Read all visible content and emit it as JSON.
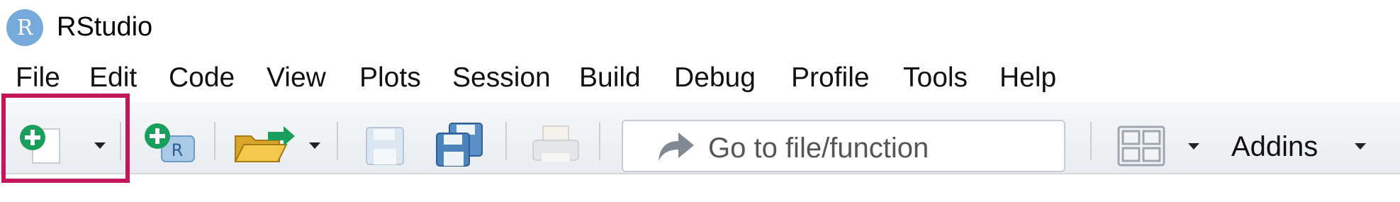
{
  "app": {
    "title": "RStudio",
    "logo_letter": "R"
  },
  "menu": {
    "items": [
      "File",
      "Edit",
      "Code",
      "View",
      "Plots",
      "Session",
      "Build",
      "Debug",
      "Profile",
      "Tools",
      "Help"
    ]
  },
  "toolbar": {
    "new_file_icon": "new-file-plus-icon",
    "new_project_icon": "new-project-icon",
    "open_file_icon": "open-folder-icon",
    "save_icon": "save-icon",
    "save_all_icon": "save-all-icon",
    "print_icon": "print-icon",
    "goto_placeholder": "Go to file/function",
    "layout_icon": "pane-layout-icon",
    "addins_label": "Addins"
  },
  "colors": {
    "highlight": "#c2185b",
    "accent_green": "#1a9e5c",
    "logo_blue": "#75aadb"
  }
}
